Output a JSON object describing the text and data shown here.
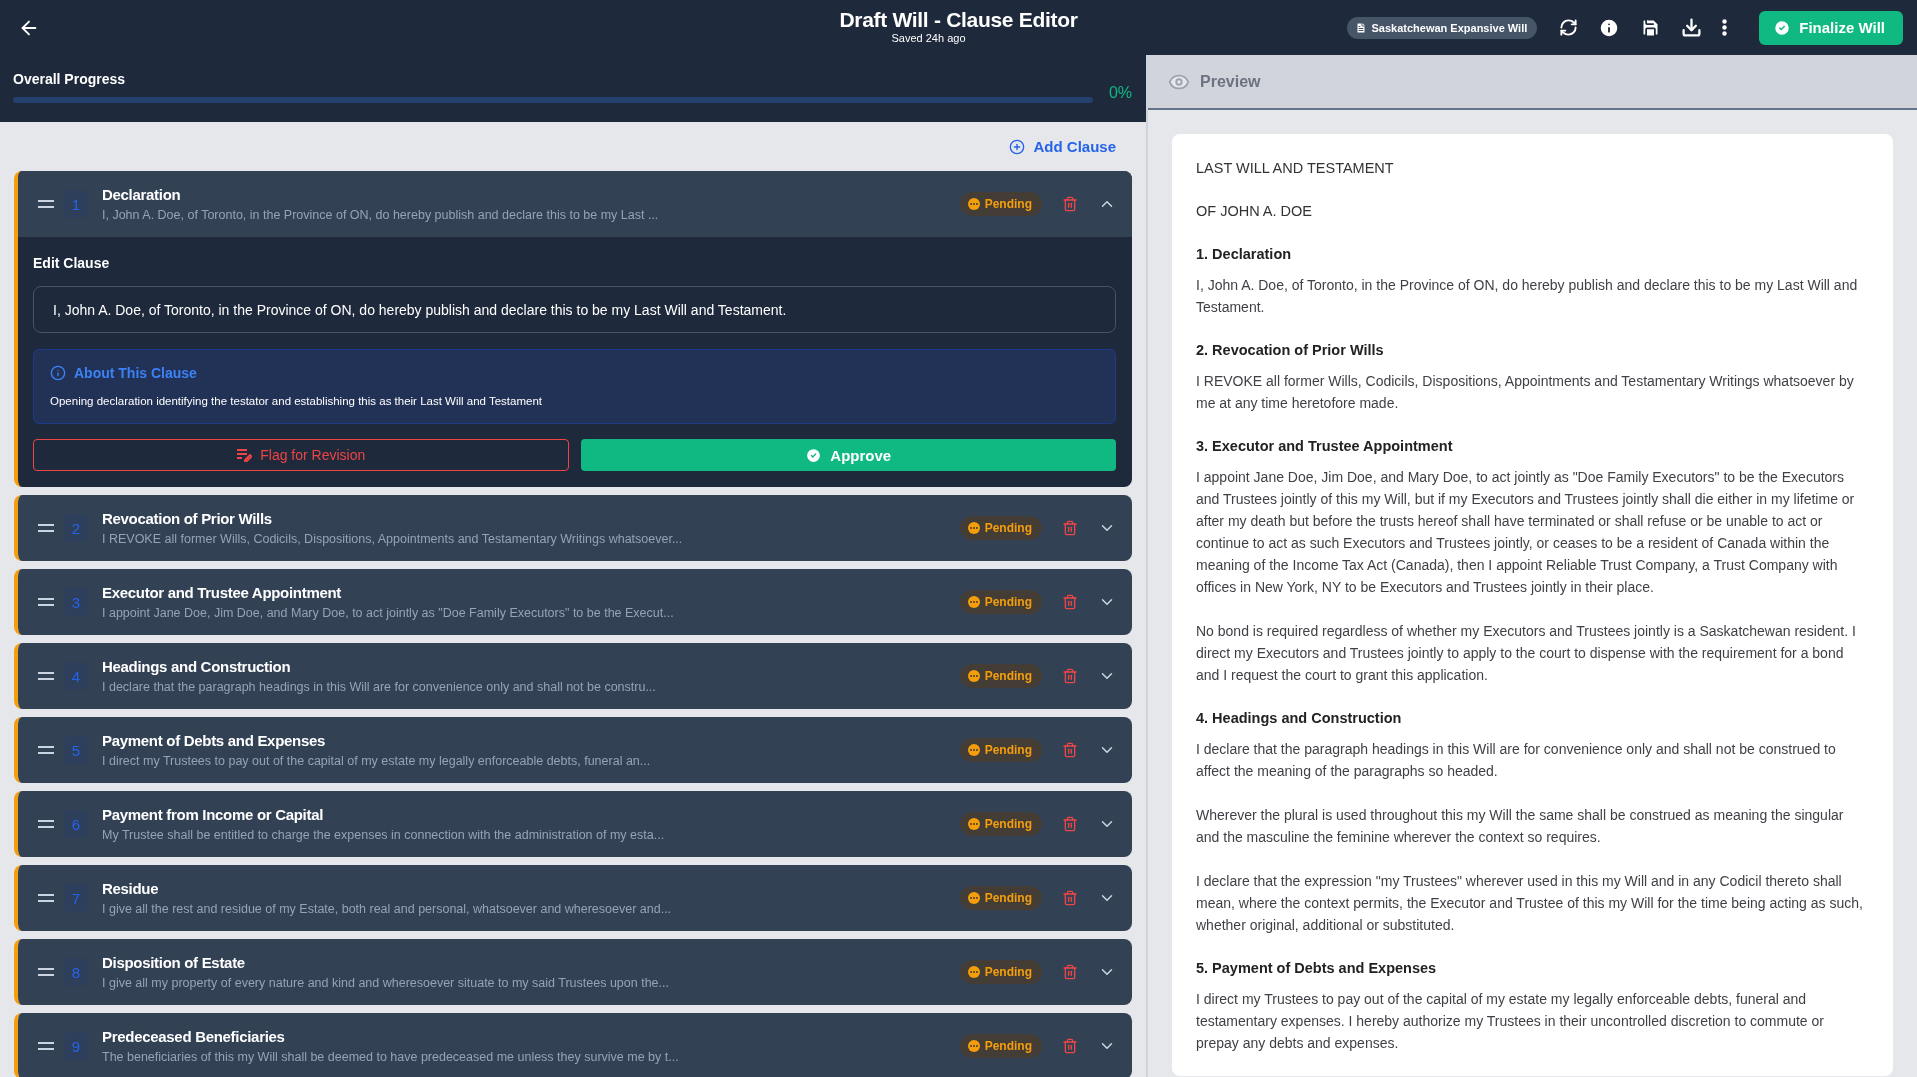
{
  "header": {
    "title": "Draft Will - Clause Editor",
    "subtitle": "Saved 24h ago",
    "template_chip": "Saskatchewan Expansive Will",
    "finalize_button": "Finalize Will"
  },
  "progress": {
    "label": "Overall Progress",
    "value": "0%",
    "level": 0
  },
  "add_clause": "Add Clause",
  "clauses": [
    {
      "number": "1",
      "title": "Declaration",
      "summary": "I, John A. Doe, of Toronto, in the Province of ON, do hereby publish and declare this to be my Last ...",
      "status": "Pending",
      "expanded": true,
      "edit_label": "Edit Clause",
      "text": "I, John A. Doe, of Toronto, in the Province of ON, do hereby publish and declare this to be my Last Will and Testament.",
      "about_title": "About This Clause",
      "about_text": "Opening declaration identifying the testator and establishing this as their Last Will and Testament",
      "flag_button": "Flag for Revision",
      "approve_button": "Approve"
    },
    {
      "number": "2",
      "title": "Revocation of Prior Wills",
      "summary": "I REVOKE all former Wills, Codicils, Dispositions, Appointments and Testamentary Writings whatsoever...",
      "status": "Pending",
      "expanded": false
    },
    {
      "number": "3",
      "title": "Executor and Trustee Appointment",
      "summary": "I appoint Jane Doe, Jim Doe, and Mary Doe, to act jointly as \"Doe Family Executors\" to be the Execut...",
      "status": "Pending",
      "expanded": false
    },
    {
      "number": "4",
      "title": "Headings and Construction",
      "summary": "I declare that the paragraph headings in this Will are for convenience only and shall not be constru...",
      "status": "Pending",
      "expanded": false
    },
    {
      "number": "5",
      "title": "Payment of Debts and Expenses",
      "summary": "I direct my Trustees to pay out of the capital of my estate my legally enforceable debts, funeral an...",
      "status": "Pending",
      "expanded": false
    },
    {
      "number": "6",
      "title": "Payment from Income or Capital",
      "summary": "My Trustee shall be entitled to charge the expenses in connection with the administration of my esta...",
      "status": "Pending",
      "expanded": false
    },
    {
      "number": "7",
      "title": "Residue",
      "summary": "I give all the rest and residue of my Estate, both real and personal, whatsoever and wheresoever and...",
      "status": "Pending",
      "expanded": false
    },
    {
      "number": "8",
      "title": "Disposition of Estate",
      "summary": "I give all my property of every nature and kind and wheresoever situate to my said Trustees upon the...",
      "status": "Pending",
      "expanded": false
    },
    {
      "number": "9",
      "title": "Predeceased Beneficiaries",
      "summary": "The beneficiaries of this my Will shall be deemed to have predeceased me unless they survive me by t...",
      "status": "Pending",
      "expanded": false
    }
  ],
  "preview": {
    "title": "Preview",
    "document": [
      {
        "kind": "title",
        "text": "LAST WILL AND TESTAMENT"
      },
      {
        "kind": "title",
        "text": "OF JOHN A. DOE"
      },
      {
        "kind": "heading",
        "text": "1. Declaration"
      },
      {
        "kind": "paragraph",
        "text": "I, John A. Doe, of Toronto, in the Province of ON, do hereby publish and declare this to be my Last Will and Testament."
      },
      {
        "kind": "heading",
        "text": "2. Revocation of Prior Wills"
      },
      {
        "kind": "paragraph",
        "text": "I REVOKE all former Wills, Codicils, Dispositions, Appointments and Testamentary Writings whatsoever by me at any time heretofore made."
      },
      {
        "kind": "heading",
        "text": "3. Executor and Trustee Appointment"
      },
      {
        "kind": "paragraph",
        "text": "I appoint Jane Doe, Jim Doe, and Mary Doe, to act jointly as \"Doe Family Executors\" to be the Executors and Trustees jointly of this my Will, but if my Executors and Trustees jointly shall die either in my lifetime or after my death but before the trusts hereof shall have terminated or shall refuse or be unable to act or continue to act as such Executors and Trustees jointly, or ceases to be a resident of Canada within the meaning of the Income Tax Act (Canada), then I appoint Reliable Trust Company, a Trust Company with offices in New York, NY to be Executors and Trustees jointly in their place."
      },
      {
        "kind": "paragraph",
        "text": "No bond is required regardless of whether my Executors and Trustees jointly is a Saskatchewan resident. I direct my Executors and Trustees jointly to apply to the court to dispense with the requirement for a bond and I request the court to grant this application."
      },
      {
        "kind": "heading",
        "text": "4. Headings and Construction"
      },
      {
        "kind": "paragraph",
        "text": "I declare that the paragraph headings in this Will are for convenience only and shall not be construed to affect the meaning of the paragraphs so headed."
      },
      {
        "kind": "paragraph",
        "text": "Wherever the plural is used throughout this my Will the same shall be construed as meaning the singular and the masculine the feminine wherever the context so requires."
      },
      {
        "kind": "paragraph",
        "text": "I declare that the expression \"my Trustees\" wherever used in this my Will and in any Codicil thereto shall mean, where the context permits, the Executor and Trustee of this my Will for the time being acting as such, whether original, additional or substituted."
      },
      {
        "kind": "heading",
        "text": "5. Payment of Debts and Expenses"
      },
      {
        "kind": "paragraph",
        "text": "I direct my Trustees to pay out of the capital of my estate my legally enforceable debts, funeral and testamentary expenses. I hereby authorize my Trustees in their uncontrolled discretion to commute or prepay any debts and expenses."
      }
    ]
  }
}
